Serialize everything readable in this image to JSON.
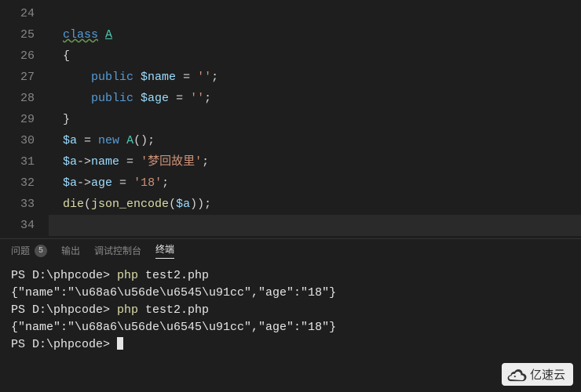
{
  "editor": {
    "lineStart": 24,
    "lines": [
      {
        "n": 24,
        "tokens": []
      },
      {
        "n": 25,
        "tokens": [
          {
            "t": "class",
            "c": "kw-blue-u"
          },
          {
            "t": " ",
            "c": "punct"
          },
          {
            "t": "A",
            "c": "classname"
          }
        ]
      },
      {
        "n": 26,
        "tokens": [
          {
            "t": "{",
            "c": "punct"
          }
        ]
      },
      {
        "n": 27,
        "tokens": [
          {
            "t": "    ",
            "c": "punct"
          },
          {
            "t": "public",
            "c": "kw-blue"
          },
          {
            "t": " ",
            "c": "punct"
          },
          {
            "t": "$name",
            "c": "var"
          },
          {
            "t": " = ",
            "c": "punct"
          },
          {
            "t": "''",
            "c": "str"
          },
          {
            "t": ";",
            "c": "punct"
          }
        ]
      },
      {
        "n": 28,
        "tokens": [
          {
            "t": "    ",
            "c": "punct"
          },
          {
            "t": "public",
            "c": "kw-blue"
          },
          {
            "t": " ",
            "c": "punct"
          },
          {
            "t": "$age",
            "c": "var"
          },
          {
            "t": " = ",
            "c": "punct"
          },
          {
            "t": "''",
            "c": "str"
          },
          {
            "t": ";",
            "c": "punct"
          }
        ]
      },
      {
        "n": 29,
        "tokens": [
          {
            "t": "}",
            "c": "punct"
          }
        ]
      },
      {
        "n": 30,
        "tokens": [
          {
            "t": "$a",
            "c": "var"
          },
          {
            "t": " = ",
            "c": "punct"
          },
          {
            "t": "new",
            "c": "kw-blue"
          },
          {
            "t": " ",
            "c": "punct"
          },
          {
            "t": "A",
            "c": "classname-plain"
          },
          {
            "t": "();",
            "c": "punct"
          }
        ]
      },
      {
        "n": 31,
        "tokens": [
          {
            "t": "$a",
            "c": "var"
          },
          {
            "t": "->",
            "c": "punct"
          },
          {
            "t": "name",
            "c": "var"
          },
          {
            "t": " = ",
            "c": "punct"
          },
          {
            "t": "'梦回故里'",
            "c": "str"
          },
          {
            "t": ";",
            "c": "punct"
          }
        ]
      },
      {
        "n": 32,
        "tokens": [
          {
            "t": "$a",
            "c": "var"
          },
          {
            "t": "->",
            "c": "punct"
          },
          {
            "t": "age",
            "c": "var"
          },
          {
            "t": " = ",
            "c": "punct"
          },
          {
            "t": "'18'",
            "c": "str"
          },
          {
            "t": ";",
            "c": "punct"
          }
        ]
      },
      {
        "n": 33,
        "tokens": [
          {
            "t": "die",
            "c": "fn"
          },
          {
            "t": "(",
            "c": "punct"
          },
          {
            "t": "json_encode",
            "c": "fn"
          },
          {
            "t": "(",
            "c": "punct"
          },
          {
            "t": "$a",
            "c": "var"
          },
          {
            "t": "));",
            "c": "punct"
          }
        ]
      },
      {
        "n": 34,
        "hl": true,
        "tokens": []
      }
    ]
  },
  "panel": {
    "tabs": {
      "problems": "问题",
      "problemsCount": "5",
      "output": "输出",
      "debug": "调试控制台",
      "terminal": "终端"
    },
    "terminal": {
      "lines": [
        {
          "seg": [
            {
              "t": "PS D:\\phpcode> ",
              "c": ""
            },
            {
              "t": "php",
              "c": "yellow"
            },
            {
              "t": " test2.php",
              "c": ""
            }
          ]
        },
        {
          "seg": [
            {
              "t": "{\"name\":\"\\u68a6\\u56de\\u6545\\u91cc\",\"age\":\"18\"}",
              "c": ""
            }
          ]
        },
        {
          "seg": [
            {
              "t": "PS D:\\phpcode> ",
              "c": ""
            },
            {
              "t": "php",
              "c": "yellow"
            },
            {
              "t": " test2.php",
              "c": ""
            }
          ]
        },
        {
          "seg": [
            {
              "t": "{\"name\":\"\\u68a6\\u56de\\u6545\\u91cc\",\"age\":\"18\"}",
              "c": ""
            }
          ]
        },
        {
          "seg": [
            {
              "t": "PS D:\\phpcode> ",
              "c": ""
            }
          ],
          "cursor": true
        }
      ]
    }
  },
  "watermark": {
    "text": "亿速云"
  }
}
